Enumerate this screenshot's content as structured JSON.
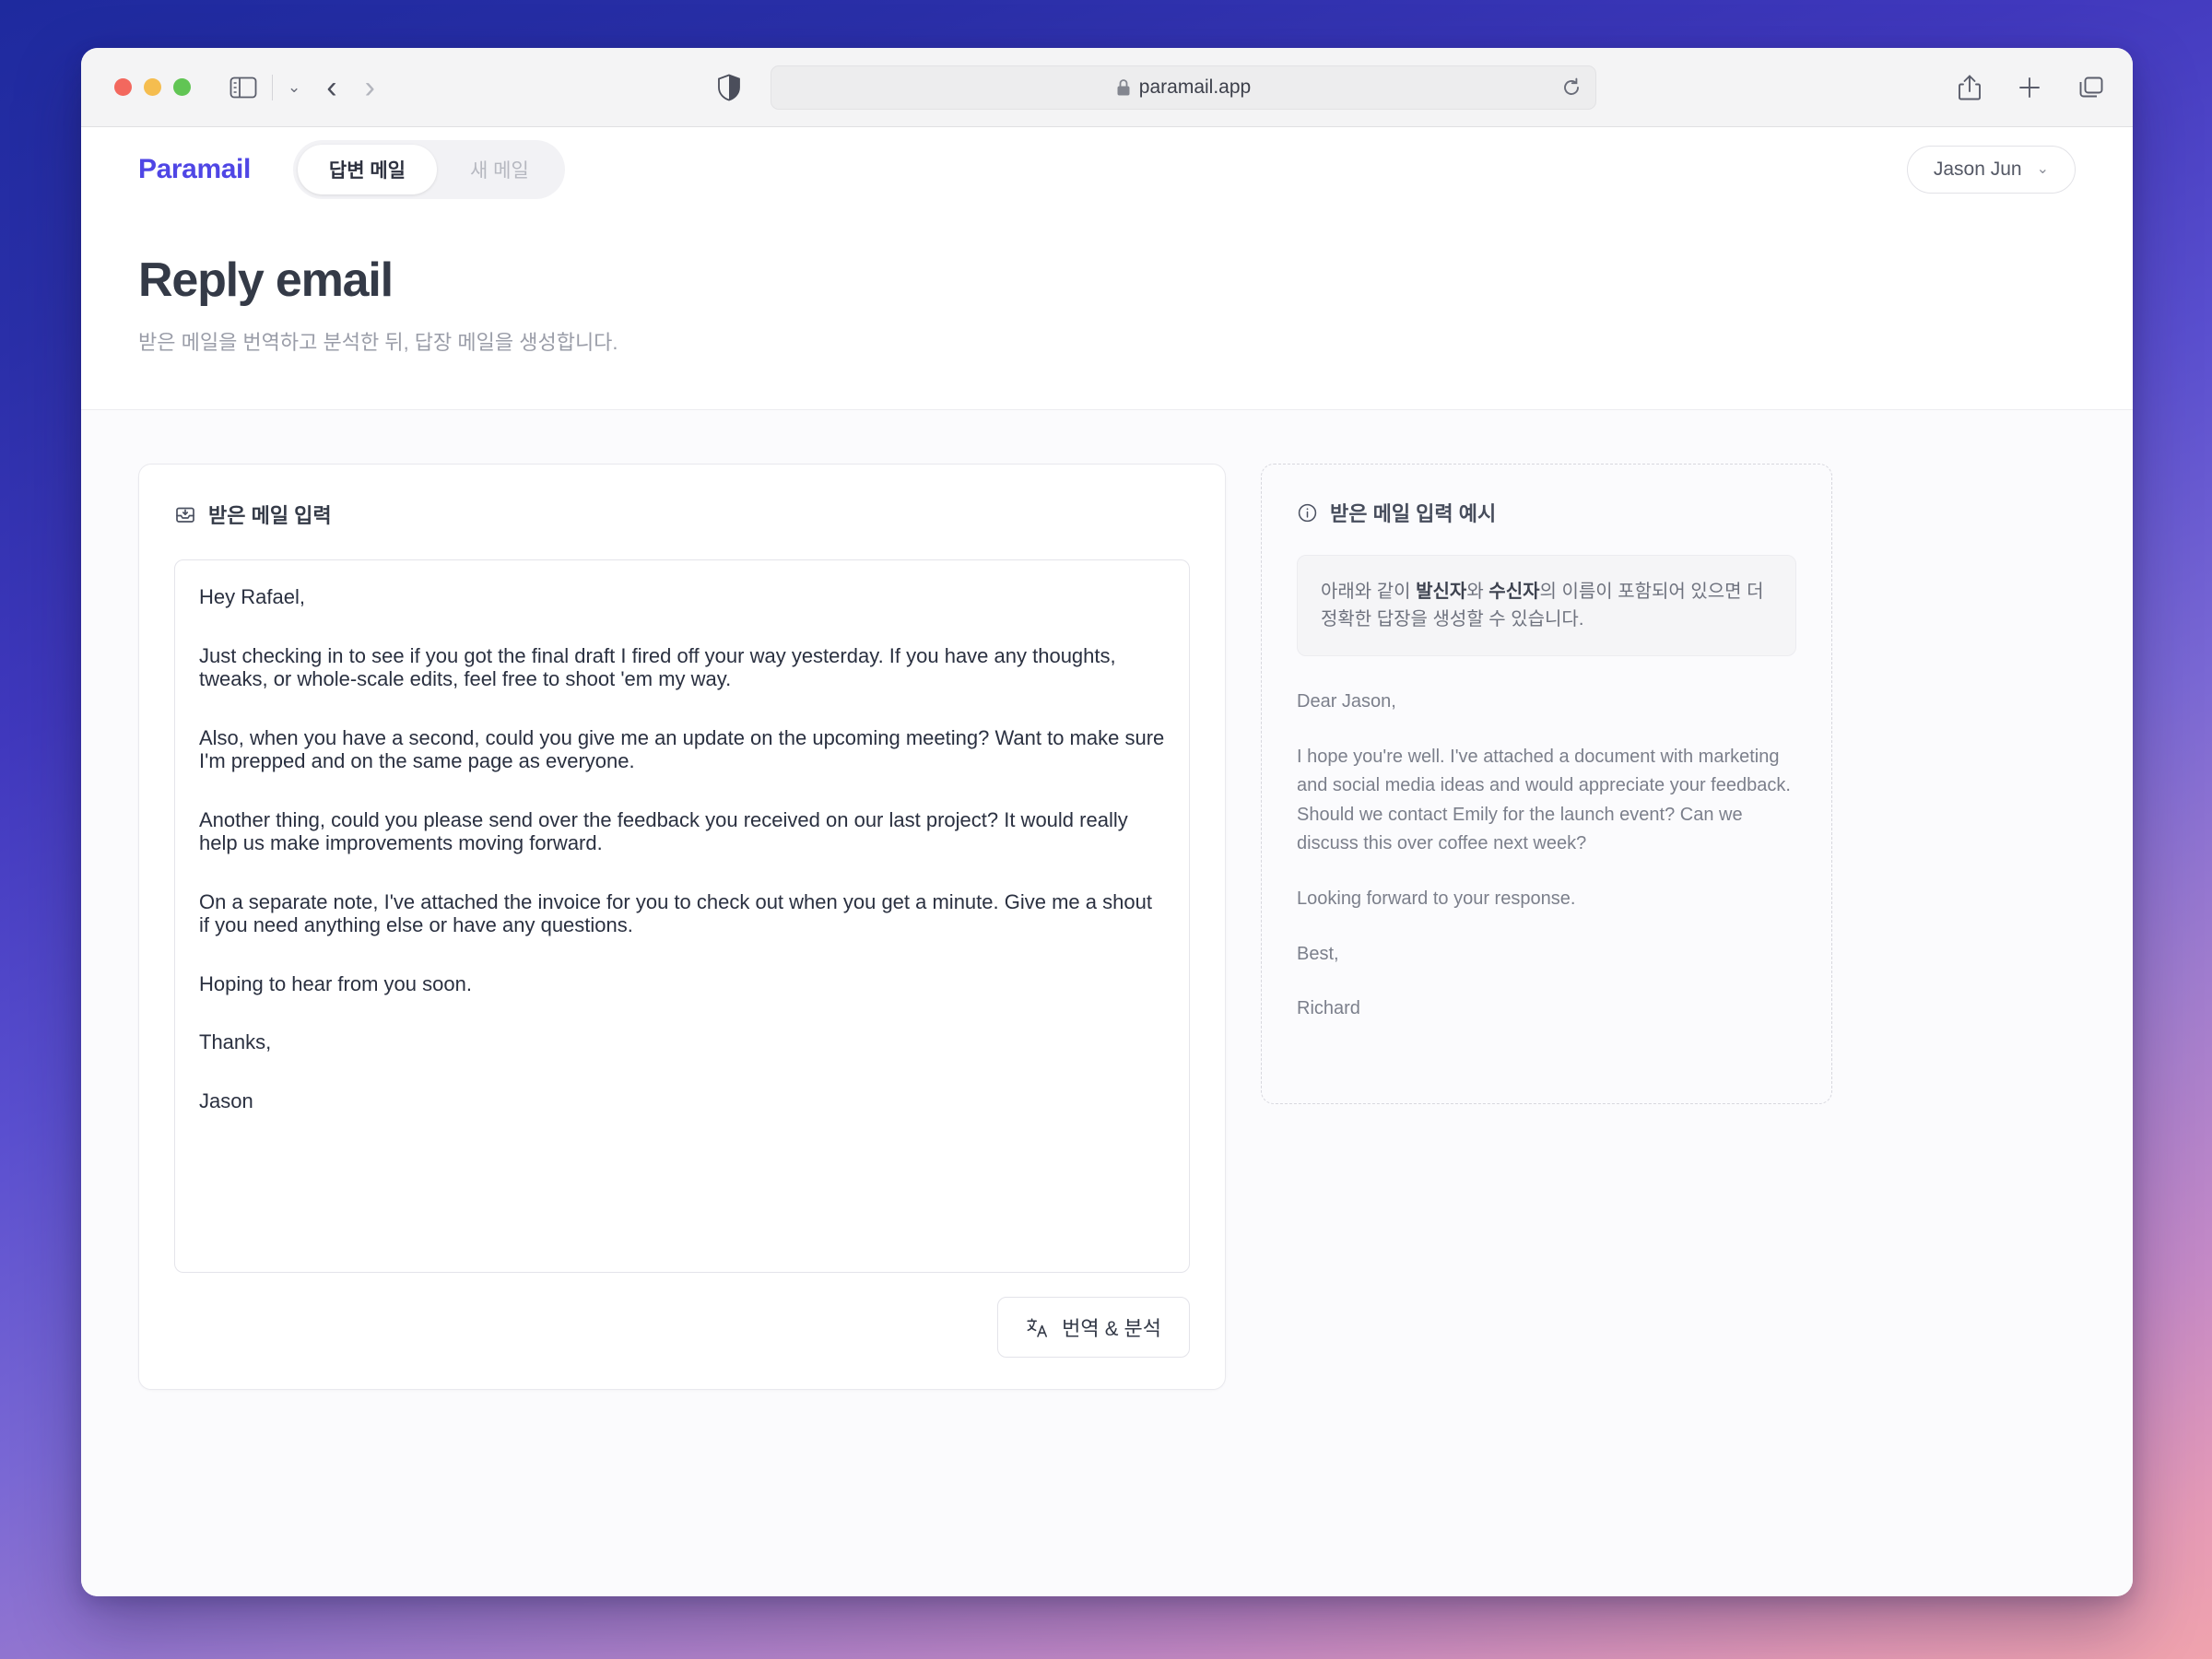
{
  "browser": {
    "url": "paramail.app",
    "lock_icon": "lock-icon",
    "reload_icon": "reload-icon",
    "shield_icon": "shield-icon",
    "sidebar_icon": "sidebar-icon",
    "back_icon": "‹",
    "forward_icon": "›",
    "chevron_icon": "⌄",
    "share_icon": "share-icon",
    "new_tab_icon": "plus-icon",
    "tabs_overview_icon": "tabs-overview-icon"
  },
  "app": {
    "brand": "Paramail",
    "brand_color": "#4f46e5",
    "tabs": [
      {
        "label": "답변 메일",
        "active": true
      },
      {
        "label": "새 메일",
        "active": false
      }
    ],
    "user": {
      "name": "Jason Jun",
      "chevron": "⌄"
    },
    "page": {
      "title": "Reply email",
      "subtitle": "받은 메일을 번역하고 분석한 뒤, 답장 메일을 생성합니다."
    },
    "input_card": {
      "icon": "inbox-icon",
      "title": "받은 메일 입력",
      "mail_paragraphs": [
        "Hey Rafael,",
        "Just checking in to see if you got the final draft I fired off your way yesterday. If you have any thoughts, tweaks, or whole-scale edits, feel free to shoot 'em my way.",
        "Also, when you have a second, could you give me an update on the upcoming meeting? Want to make sure I'm prepped and on the same page as everyone.",
        "Another thing, could you please send over the feedback you received on our last project? It would really help us make improvements moving forward.",
        "On a separate note, I've attached the invoice for you to check out when you get a minute. Give me a shout if you need anything else or have any questions.",
        "Hoping to hear from you soon.",
        "Thanks,",
        "Jason"
      ],
      "translate_button": {
        "icon": "translate-icon",
        "label": "번역 & 분석"
      }
    },
    "example_card": {
      "icon": "info-icon",
      "title": "받은 메일 입력 예시",
      "hint": {
        "part1": "아래와 같이 ",
        "bold1": "발신자",
        "part2": "와 ",
        "bold2": "수신자",
        "part3": "의 이름이 포함되어 있으면 더 정확한 답장을 생성할 수 있습니다."
      },
      "example_paragraphs": [
        "Dear Jason,",
        "I hope you're well. I've attached a document with marketing and social media ideas and would appreciate your feedback. Should we contact Emily for the launch event? Can we discuss this over coffee next week?",
        "Looking forward to your response.",
        "Best,",
        "Richard"
      ]
    }
  }
}
